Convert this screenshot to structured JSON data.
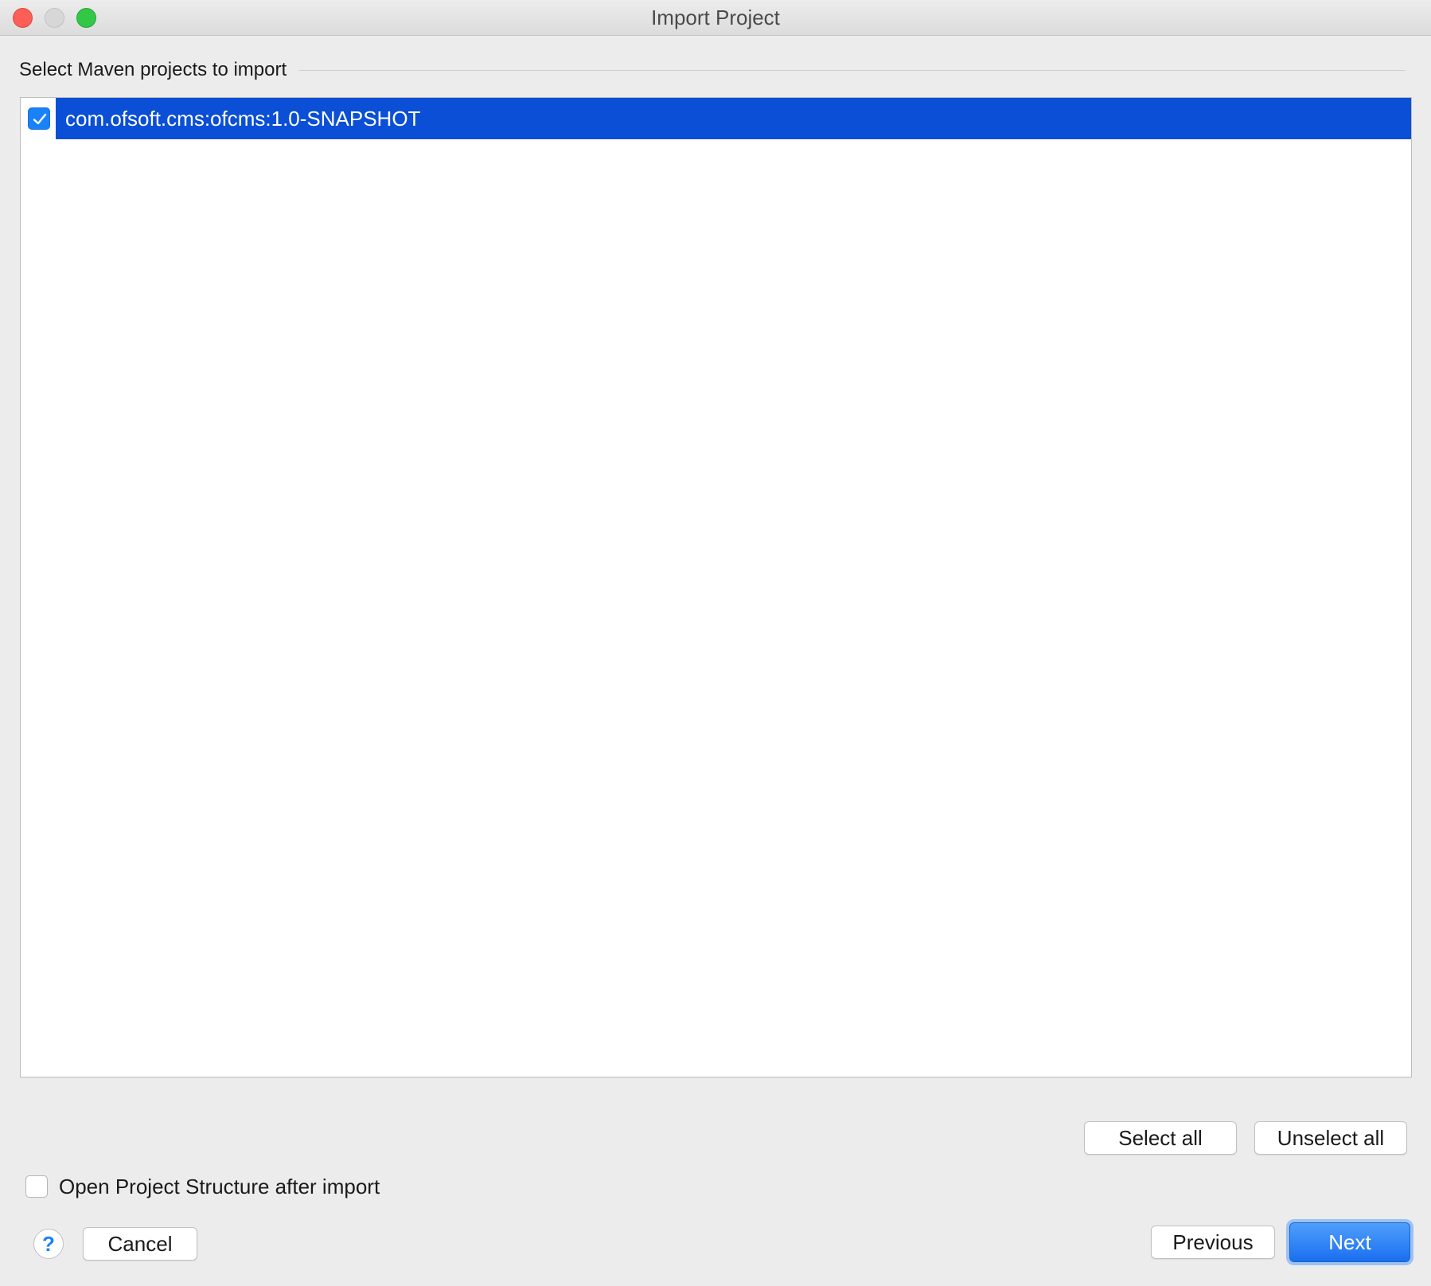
{
  "window": {
    "title": "Import Project"
  },
  "section": {
    "label": "Select Maven projects to import"
  },
  "projects": [
    {
      "name": "com.ofsoft.cms:ofcms:1.0-SNAPSHOT",
      "checked": true,
      "selected": true
    }
  ],
  "selection_buttons": {
    "select_all": "Select all",
    "unselect_all": "Unselect all"
  },
  "options": {
    "open_structure_label": "Open Project Structure after import",
    "open_structure_checked": false
  },
  "footer": {
    "help": "?",
    "cancel": "Cancel",
    "previous": "Previous",
    "next": "Next"
  },
  "colors": {
    "selection": "#0a4fd6",
    "checkbox_on": "#1a82f8",
    "primary_button": "#1a6ff0"
  }
}
